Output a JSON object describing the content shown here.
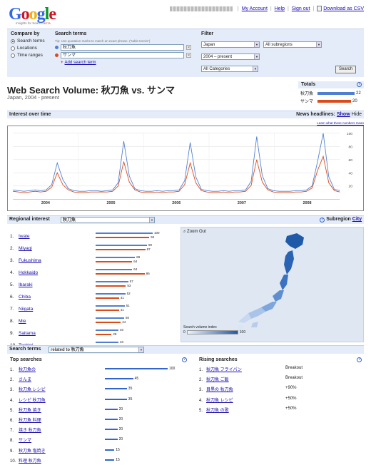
{
  "header": {
    "logo_text": "Google",
    "logo_sub": "Insights for Search",
    "logo_badge": "BETA",
    "links": [
      "My Account",
      "Help",
      "Sign out",
      "Download as CSV"
    ],
    "logo_colors": [
      "#3369e8",
      "#d50f25",
      "#eeb211",
      "#3369e8",
      "#009925",
      "#d50f25"
    ]
  },
  "compare": {
    "title": "Compare by",
    "options": [
      {
        "label": "Search terms",
        "selected": true
      },
      {
        "label": "Locations",
        "selected": false
      },
      {
        "label": "Time ranges",
        "selected": false
      }
    ]
  },
  "search_terms": {
    "title": "Search terms",
    "tip": "Tip: Use quotation marks to match an exact phrase. (\"table tennis\")",
    "terms": [
      {
        "value": "秋刀魚",
        "color": "#4f7fd3"
      },
      {
        "value": "サンマ",
        "color": "#dc4a1a"
      }
    ],
    "add_link": "Add search term"
  },
  "filter": {
    "title": "Filter",
    "country": "Japan",
    "subregion": "All subregions",
    "time": "2004 – present",
    "category": "All Categories",
    "search_button": "Search"
  },
  "page": {
    "title": "Web Search Volume: 秋刀魚 vs. サンマ",
    "subtitle": "Japan, 2004 - present"
  },
  "totals": {
    "title": "Totals",
    "rows": [
      {
        "label": "秋刀魚",
        "value": 22,
        "color": "#4f7fd3"
      },
      {
        "label": "サンマ",
        "value": 20,
        "color": "#dc4a1a"
      }
    ]
  },
  "interest": {
    "title": "Interest over time",
    "news_label": "News headlines:",
    "show": "Show",
    "hide": "Hide",
    "learn_more": "Learn what these numbers mean",
    "y_ticks": [
      100,
      80,
      60,
      40,
      20
    ],
    "years": [
      "2004",
      "2005",
      "2006",
      "2007",
      "2008"
    ]
  },
  "chart_data": {
    "type": "line",
    "title": "Interest over time",
    "xlabel": "",
    "ylabel": "",
    "ylim": [
      0,
      100
    ],
    "x_ticks": [
      "2004",
      "2005",
      "2006",
      "2007",
      "2008"
    ],
    "series": [
      {
        "name": "秋刀魚",
        "color": "#4f7fd3",
        "values": [
          14,
          13,
          12,
          13,
          14,
          13,
          14,
          22,
          55,
          30,
          16,
          13,
          12,
          12,
          13,
          13,
          12,
          13,
          14,
          25,
          88,
          35,
          16,
          13,
          12,
          12,
          13,
          12,
          13,
          13,
          14,
          28,
          86,
          34,
          15,
          13,
          12,
          12,
          13,
          12,
          13,
          13,
          14,
          27,
          95,
          36,
          16,
          13,
          12,
          12,
          12,
          13,
          13,
          14,
          20,
          58,
          100,
          34,
          15,
          13
        ]
      },
      {
        "name": "サンマ",
        "color": "#dc4a1a",
        "values": [
          12,
          11,
          10,
          11,
          12,
          11,
          12,
          18,
          40,
          22,
          14,
          11,
          10,
          10,
          11,
          11,
          11,
          11,
          12,
          20,
          57,
          26,
          14,
          11,
          10,
          10,
          11,
          10,
          11,
          11,
          12,
          22,
          55,
          25,
          13,
          11,
          10,
          10,
          11,
          10,
          11,
          11,
          12,
          21,
          60,
          26,
          14,
          11,
          10,
          10,
          10,
          11,
          11,
          12,
          17,
          44,
          65,
          25,
          13,
          11
        ]
      }
    ]
  },
  "regional": {
    "title": "Regional interest",
    "term": "秋刀魚",
    "subregion_label": "Subregion",
    "city_label": "City",
    "zoom_out": "Zoom Out",
    "legend_title": "Search volume index",
    "legend_min": "0",
    "legend_max": "100",
    "rows": [
      {
        "rank": "1.",
        "name": "Iwate",
        "a": 100,
        "b": 94
      },
      {
        "rank": "2.",
        "name": "Miyagi",
        "a": 90,
        "b": 87
      },
      {
        "rank": "3.",
        "name": "Fukushima",
        "a": 69,
        "b": 64
      },
      {
        "rank": "4.",
        "name": "Hokkaido",
        "a": 64,
        "b": 86
      },
      {
        "rank": "5.",
        "name": "Ibaraki",
        "a": 57,
        "b": 53
      },
      {
        "rank": "6.",
        "name": "Chiba",
        "a": 52,
        "b": 41
      },
      {
        "rank": "7.",
        "name": "Niigata",
        "a": 51,
        "b": 41
      },
      {
        "rank": "8.",
        "name": "Mie",
        "a": 50,
        "b": 44
      },
      {
        "rank": "9.",
        "name": "Saitama",
        "a": 40,
        "b": 28
      },
      {
        "rank": "10.",
        "name": "Tochigi",
        "a": 40,
        "b": 40
      }
    ]
  },
  "terms_section": {
    "title": "Search terms",
    "related": "related to 秋刀魚",
    "top_title": "Top searches",
    "rising_title": "Rising searches",
    "top": [
      {
        "rank": "1.",
        "term": "秋刀魚の",
        "value": 100
      },
      {
        "rank": "2.",
        "term": "さんま",
        "value": 45
      },
      {
        "rank": "3.",
        "term": "秋刀魚 レシピ",
        "value": 35
      },
      {
        "rank": "4.",
        "term": "レシピ 秋刀魚",
        "value": 35
      },
      {
        "rank": "5.",
        "term": "秋刀魚 焼き",
        "value": 20
      },
      {
        "rank": "6.",
        "term": "秋刀魚 料理",
        "value": 20
      },
      {
        "rank": "7.",
        "term": "焼き 秋刀魚",
        "value": 20
      },
      {
        "rank": "8.",
        "term": "サンマ",
        "value": 20
      },
      {
        "rank": "9.",
        "term": "秋刀魚 塩焼き",
        "value": 15
      },
      {
        "rank": "10.",
        "term": "料理 秋刀魚",
        "value": 15
      }
    ],
    "rising": [
      {
        "rank": "1.",
        "term": "秋刀魚 フライパン",
        "value": "Breakout"
      },
      {
        "rank": "2.",
        "term": "秋刀魚 ご飯",
        "value": "Breakout"
      },
      {
        "rank": "3.",
        "term": "目黒の 秋刀魚",
        "value": "+90%"
      },
      {
        "rank": "4.",
        "term": "秋刀魚 レシピ",
        "value": "+50%"
      },
      {
        "rank": "5.",
        "term": "秋刀魚 の歌",
        "value": "+50%"
      }
    ]
  }
}
